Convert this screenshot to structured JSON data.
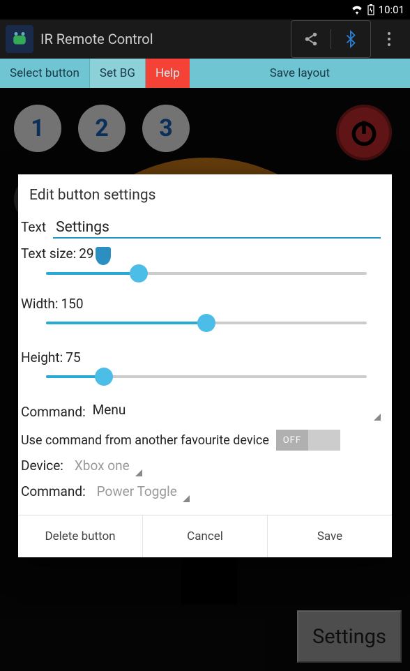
{
  "status": {
    "time": "10:01"
  },
  "actionbar": {
    "title": "IR Remote Control"
  },
  "toolbar": {
    "select": "Select button",
    "setbg": "Set BG",
    "help": "Help",
    "save": "Save layout"
  },
  "remote": {
    "numrow1": [
      "1",
      "2",
      "3"
    ],
    "settings_btn": "Settings"
  },
  "dialog": {
    "title": "Edit button settings",
    "text_label": "Text",
    "text_value": "Settings",
    "textsize_label": "Text size:",
    "textsize_value": "29",
    "textsize_pct": 29,
    "width_label": "Width:",
    "width_value": "150",
    "width_pct": 50,
    "height_label": "Height:",
    "height_value": "75",
    "height_pct": 18,
    "command_label": "Command:",
    "command_value": "Menu",
    "fav_label": "Use command from another favourite device",
    "fav_toggle": "OFF",
    "device_label": "Device:",
    "device_value": "Xbox one",
    "command2_label": "Command:",
    "command2_value": "Power Toggle",
    "actions": {
      "delete": "Delete button",
      "cancel": "Cancel",
      "save": "Save"
    }
  }
}
